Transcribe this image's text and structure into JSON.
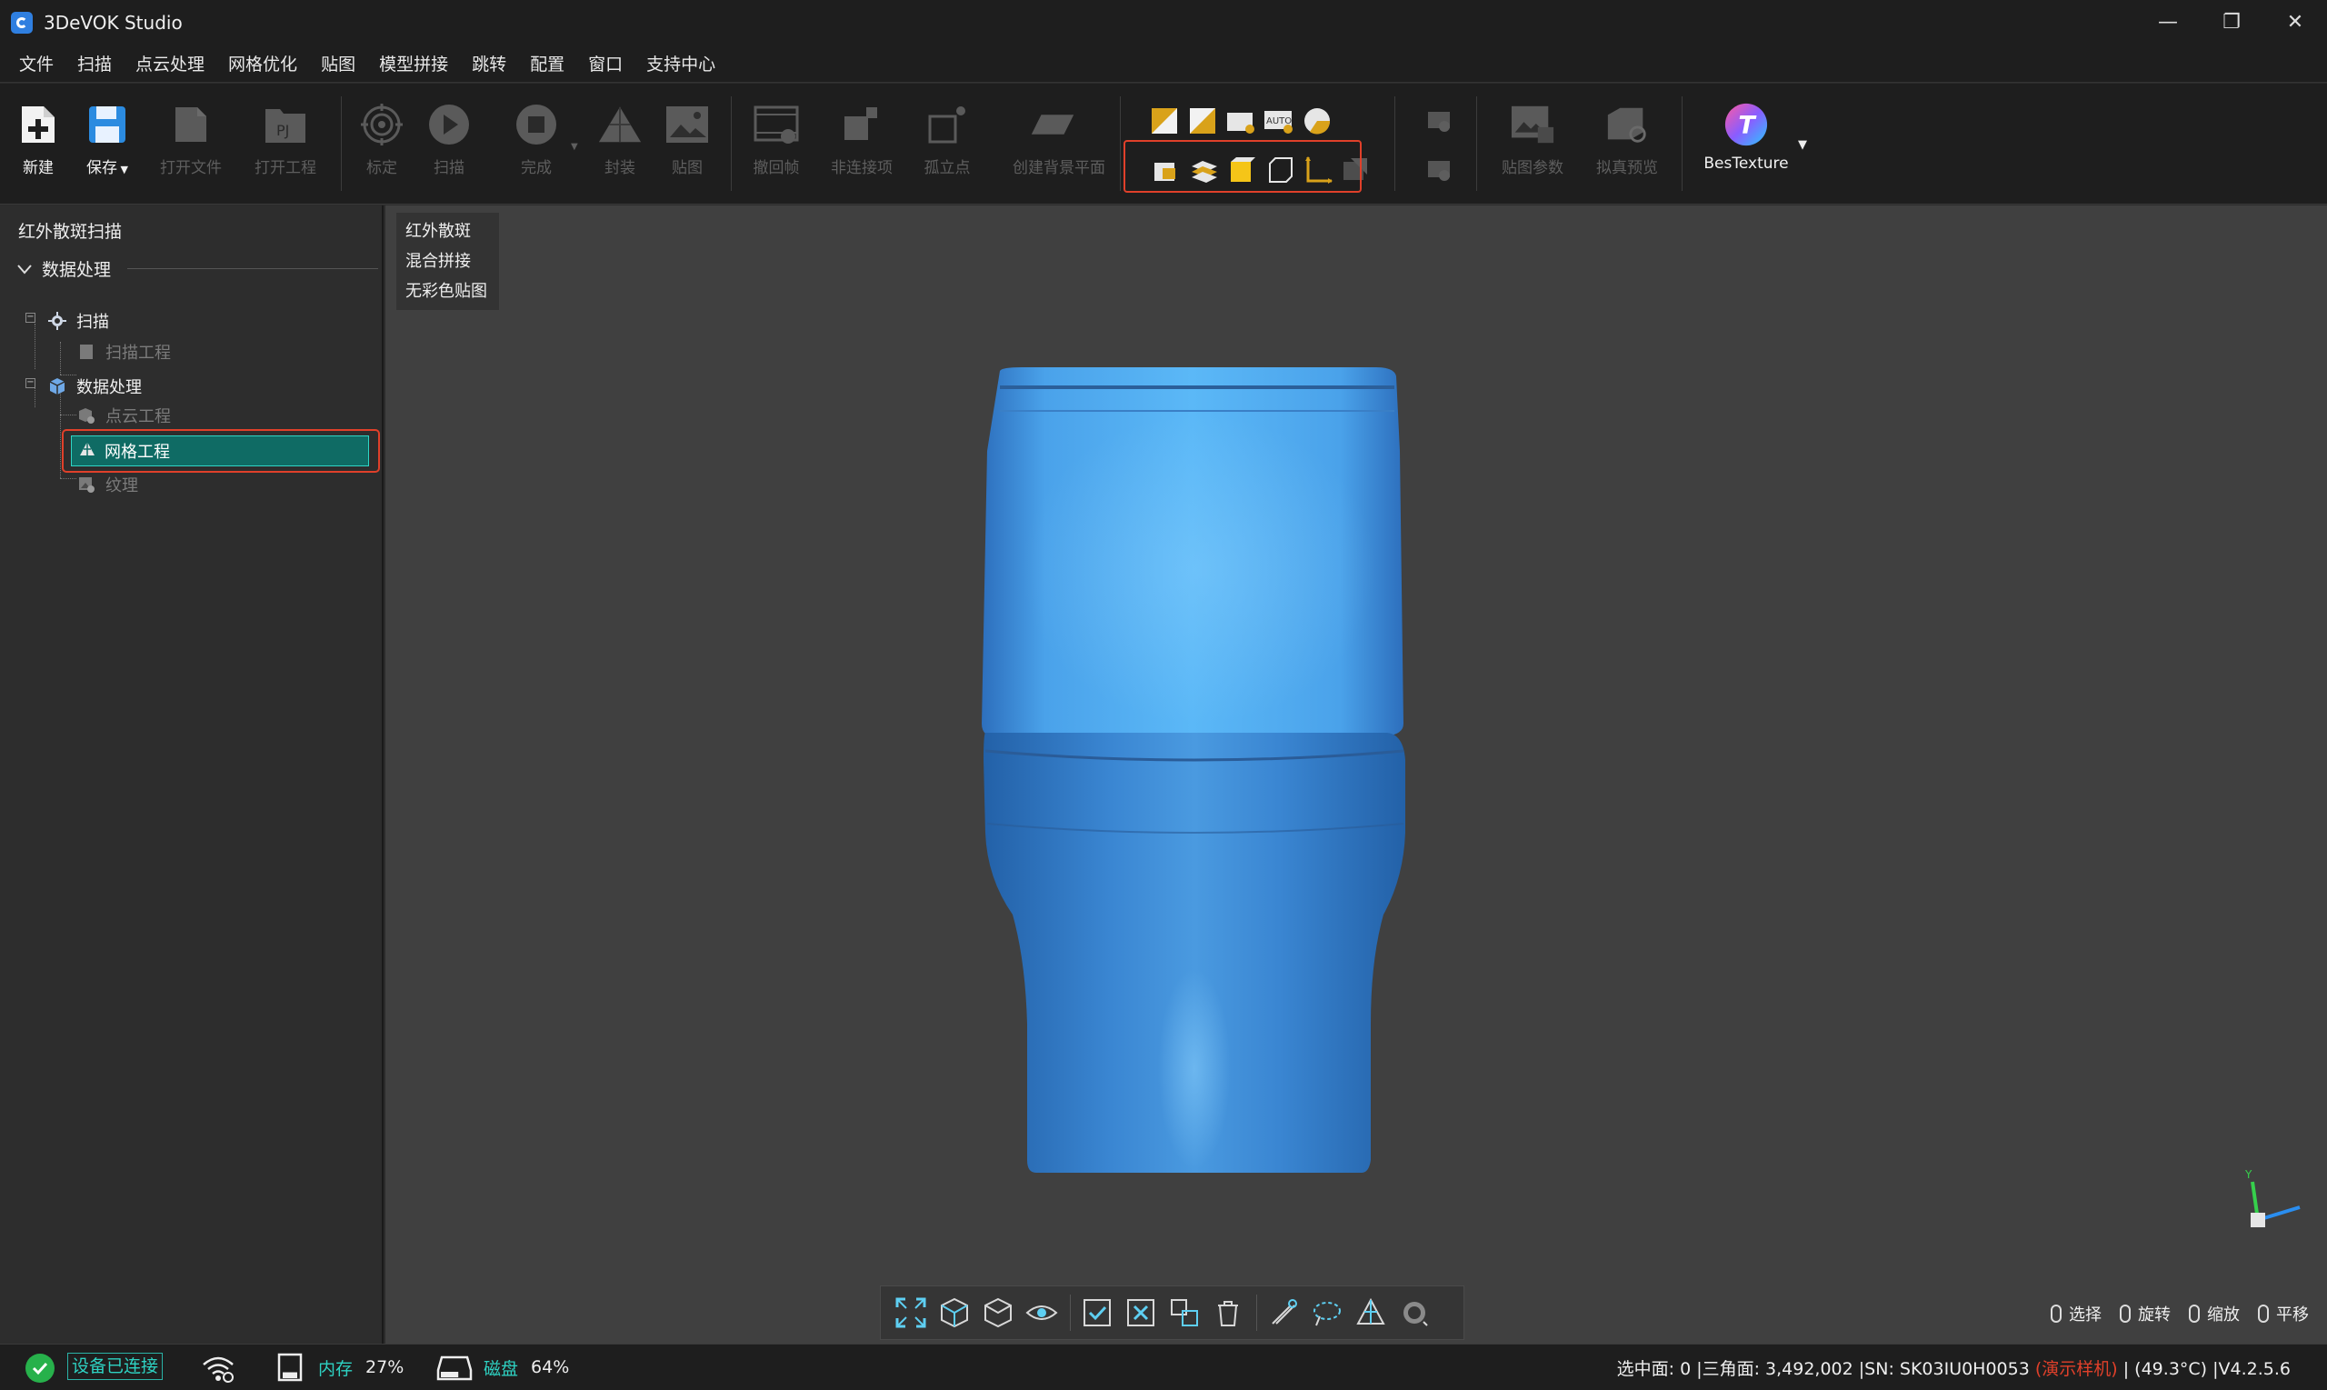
{
  "window": {
    "title": "3DeVOK Studio",
    "controls": [
      "—",
      "❐",
      "✕"
    ]
  },
  "menu": [
    "文件",
    "扫描",
    "点云处理",
    "网格优化",
    "贴图",
    "模型拼接",
    "跳转",
    "配置",
    "窗口",
    "支持中心"
  ],
  "toolbar": {
    "new": "新建",
    "save": "保存",
    "open_file": "打开文件",
    "open_project": "打开工程",
    "open_project_badge": "PJ",
    "calibrate": "标定",
    "scan": "扫描",
    "finish": "完成",
    "encapsulate": "封装",
    "texture": "贴图",
    "undo_frame": "撤回帧",
    "non_connected": "非连接项",
    "isolated_points": "孤立点",
    "create_bg_plane": "创建背景平面",
    "texture_params": "贴图参数",
    "capture_preview": "拟真预览",
    "bestexture": "BesTexture",
    "auto_badge": "AUTO"
  },
  "left_panel": {
    "scan_mode_title": "红外散斑扫描",
    "section": "数据处理",
    "tree": {
      "scan": "扫描",
      "scan_project": "扫描工程",
      "data_processing": "数据处理",
      "point_cloud_project": "点云工程",
      "mesh_project": "网格工程",
      "texture": "纹理"
    }
  },
  "viewport": {
    "mode_menu": [
      "红外散斑",
      "混合拼接",
      "无彩色贴图"
    ],
    "mouse_hints": [
      "选择",
      "旋转",
      "缩放",
      "平移"
    ],
    "axis_y": "Y"
  },
  "status": {
    "connected": "设备已连接",
    "memory_label": "内存",
    "memory_value": "27%",
    "memory_fill": 0.27,
    "disk_label": "磁盘",
    "disk_value": "64%",
    "disk_fill": 0.64,
    "selected_faces": "选中面: 0 |三角面: 3,492,002 |SN: SK03IU0H0053 ",
    "demo_tag": "(演示样机)",
    "temp_version": " | (49.3°C) |V4.2.5.6"
  },
  "colors": {
    "accent": "#2ed2c3",
    "highlight_box": "#e0402a",
    "model_blue": "#2f7fd0",
    "connected_green": "#27b14b"
  }
}
